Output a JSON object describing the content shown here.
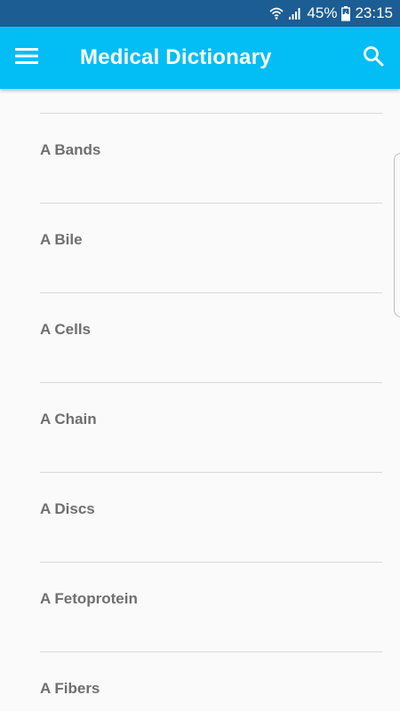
{
  "status_bar": {
    "battery": "45%",
    "time": "23:15",
    "icons": [
      "wifi-icon",
      "signal-icon",
      "battery-charging-icon"
    ]
  },
  "app_bar": {
    "title": "Medical Dictionary",
    "menu_icon": "menu-icon",
    "search_icon": "search-icon",
    "color": "#03bdf5"
  },
  "terms": [
    {
      "label": "A Bands"
    },
    {
      "label": "A Bile"
    },
    {
      "label": "A Cells"
    },
    {
      "label": "A Chain"
    },
    {
      "label": "A Discs"
    },
    {
      "label": "A Fetoprotein"
    },
    {
      "label": "A Fibers"
    }
  ]
}
